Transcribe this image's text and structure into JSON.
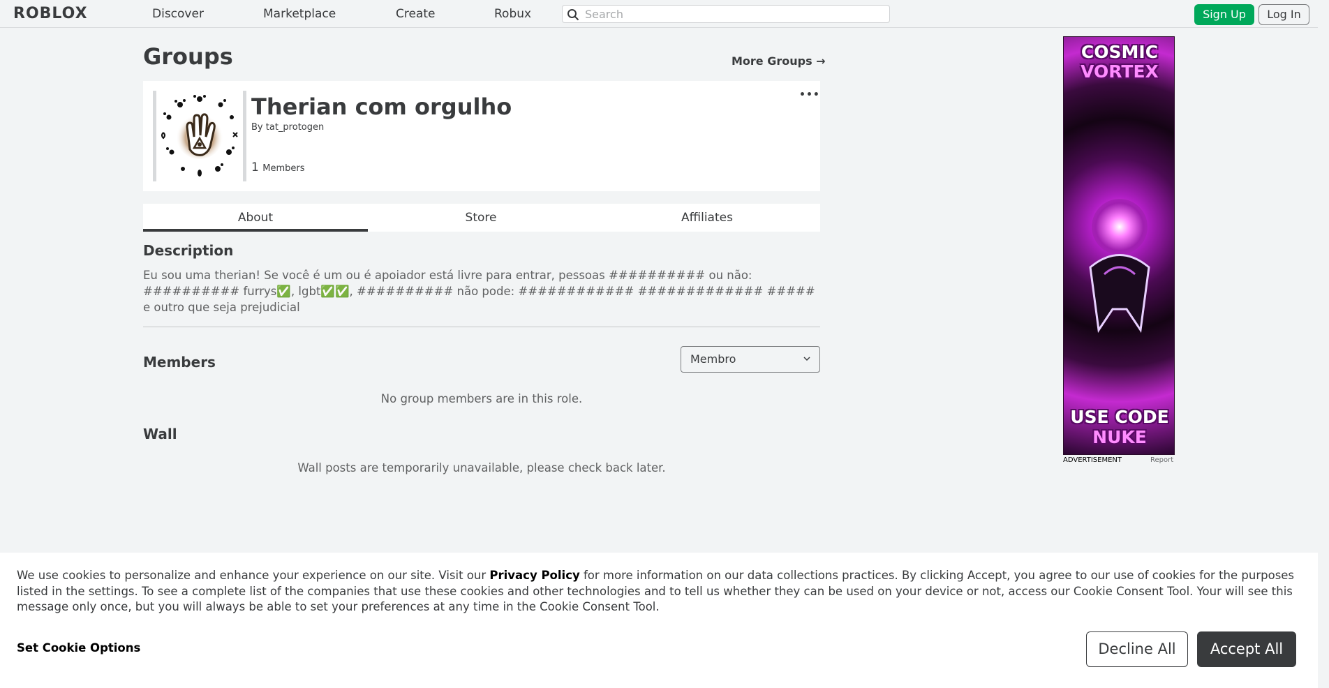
{
  "nav": {
    "logo": "ROBLOX",
    "links": [
      "Discover",
      "Marketplace",
      "Create",
      "Robux"
    ],
    "search_placeholder": "Search",
    "signup_label": "Sign Up",
    "login_label": "Log In"
  },
  "page": {
    "heading": "Groups",
    "more_groups": "More Groups →"
  },
  "group": {
    "name": "Therian com orgulho",
    "by_label": "By",
    "owner": "tat_protogen",
    "member_count": "1",
    "members_label": "Members",
    "menu": "•••"
  },
  "tabs": [
    "About",
    "Store",
    "Affiliates"
  ],
  "description": {
    "heading": "Description",
    "text": "Eu sou uma therian! Se você é um ou é apoiador está livre para entrar, pessoas ########## ou não: ########## furrys✅, lgbt✅✅, ########## não pode: ############ ############# ##### e outro que seja prejudicial"
  },
  "members": {
    "heading": "Members",
    "role_selected": "Membro",
    "empty_text": "No group members are in this role."
  },
  "wall": {
    "heading": "Wall",
    "unavailable_text": "Wall posts are temporarily unavailable, please check back later."
  },
  "ad": {
    "title_line1": "COSMIC",
    "title_line2": "VORTEX",
    "code_line1": "USE CODE",
    "code_line2": "NUKE",
    "label": "ADVERTISEMENT",
    "report": "Report"
  },
  "cookie": {
    "text_before": "We use cookies to personalize and enhance your experience on our site. Visit our ",
    "privacy_link": "Privacy Policy",
    "text_after": " for more information on our data collections practices. By clicking Accept, you agree to our use of cookies for the purposes listed in the settings. To see a complete list of the companies that use these cookies and other technologies and to tell us whether they can be used on your device or not, access our Cookie Consent Tool. Your will see this message only once, but you will always be able to set your preferences at any time in the Cookie Consent Tool.",
    "options_label": "Set Cookie Options",
    "decline_label": "Decline All",
    "accept_label": "Accept All"
  },
  "colors": {
    "signup_green": "#00a85a",
    "accept_dark": "#393b3d",
    "background": "#f2f4f5"
  }
}
